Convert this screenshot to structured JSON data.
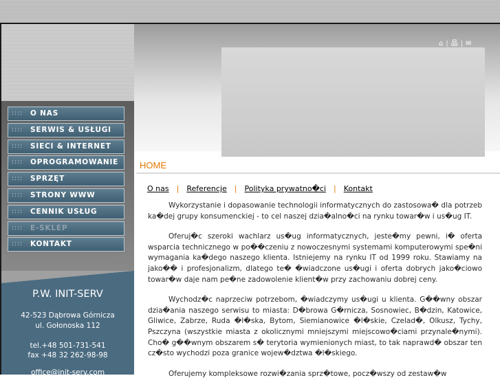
{
  "nav": {
    "items": [
      {
        "dots": "::::",
        "label": "O NAS"
      },
      {
        "dots": "::::",
        "label": "SERWIS & USŁUGI"
      },
      {
        "dots": "::::",
        "label": "SIECI & INTERNET"
      },
      {
        "dots": "::::",
        "label": "OPROGRAMOWANIE"
      },
      {
        "dots": "::::",
        "label": "SPRZĘT"
      },
      {
        "dots": "::::",
        "label": "STRONY WWW"
      },
      {
        "dots": "::::",
        "label": "CENNIK USŁUG"
      },
      {
        "dots": "::::",
        "label": "E-SKLEP"
      },
      {
        "dots": "::::",
        "label": "KONTAKT"
      }
    ]
  },
  "company": {
    "name": "P.W. INIT-SERV",
    "address_line1": "42-523 Dąbrowa Górnicza",
    "address_line2": "ul. Gołonoska 112",
    "tel": "tel.+48 501-731-541",
    "fax": "fax +48 32 262-98-98",
    "email": "office@init-serv.com"
  },
  "header": {
    "icons": [
      "home-icon",
      "sitemap-icon",
      "mail-icon"
    ],
    "icon_glyphs": [
      "⌂",
      "品",
      "✉"
    ],
    "separator": "|"
  },
  "page": {
    "title": "HOME"
  },
  "subnav": {
    "items": [
      "O nas",
      "Referencje",
      "Polityka prywatno�ci",
      "Kontakt"
    ],
    "separator": "|"
  },
  "content": {
    "paragraphs": [
      "Wykorzystanie i dopasowanie technologii informatycznych do zastosowa� dla potrzeb ka�dej grupy konsumenckiej - to cel naszej dzia�alno�ci na rynku towar�w i us�ug IT.",
      "Oferuj�c szeroki wachlarz us�ug informatycznych, jeste�my pewni, i� oferta wsparcia technicznego w po��czeniu z nowoczesnymi systemami komputerowymi spe�ni wymagania ka�dego naszego klienta. Istniejemy na rynku IT od 1999 roku. Stawiamy na jako�� i profesjonalizm, dlatego te� �wiadczone us�ugi i oferta dobrych jako�ciowo towar�w daje nam pe�ne zadowolenie klient�w przy zachowaniu dobrej ceny.",
      "Wychodz�c naprzeciw potrzebom, �wiadczymy us�ugi u klienta. G��wny obszar dzia�ania naszego serwisu to miasta: D�browa G�rnicza, Sosnowiec, B�dzin, Katowice, Gliwice, Zabrze, Ruda �l�ska, Bytom, Siemianowice �l�skie, Czelad�, Olkusz, Tychy, Pszczyna (wszystkie miasta z okolicznymi mniejszymi miejscowo�ciami przynale�nymi). Cho� g��wnym obszarem s� terytoria wymienionych miast, to tak naprawd� obszar ten cz�sto wychodzi poza granice wojew�dztwa �l�skiego.",
      "Oferujemy kompleksowe rozwi�zania sprz�towe, pocz�wszy od zestaw�w"
    ]
  },
  "colors": {
    "accent_orange": "#e07800",
    "nav_blue": "#4b6b80",
    "company_bg": "#4b6b80"
  }
}
